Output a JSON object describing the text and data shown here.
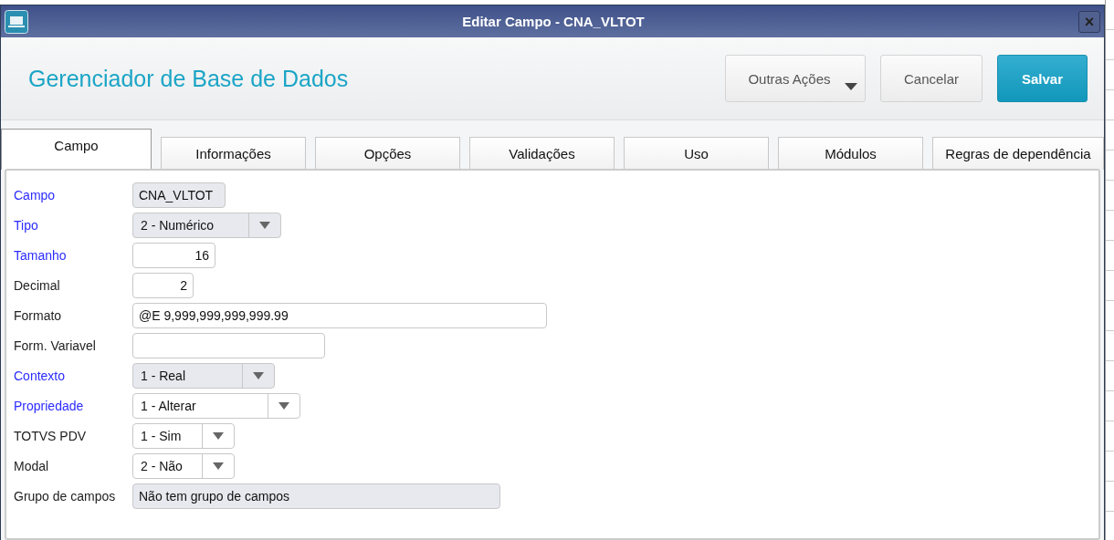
{
  "window": {
    "title": "Editar Campo - CNA_VLTOT",
    "close": "×"
  },
  "header": {
    "title": "Gerenciador de Base de Dados",
    "buttons": [
      {
        "label": "Outras Ações",
        "kind": "menu"
      },
      {
        "label": "Cancelar",
        "kind": "plain"
      },
      {
        "label": "Salvar",
        "kind": "primary"
      }
    ]
  },
  "tabs": [
    {
      "label": "Campo",
      "selected": true
    },
    {
      "label": "Informações",
      "selected": false
    },
    {
      "label": "Opções",
      "selected": false
    },
    {
      "label": "Validações",
      "selected": false
    },
    {
      "label": "Uso",
      "selected": false
    },
    {
      "label": "Módulos",
      "selected": false
    },
    {
      "label": "Regras de dependência",
      "selected": false
    }
  ],
  "fields": [
    {
      "label": "Campo",
      "required": true,
      "kind": "text",
      "value": "CNA_VLTOT",
      "disabled": true
    },
    {
      "label": "Tipo",
      "required": true,
      "kind": "select",
      "value": "2 - Numérico",
      "disabled": true
    },
    {
      "label": "Tamanho",
      "required": true,
      "kind": "number",
      "value": "16",
      "disabled": false
    },
    {
      "label": "Decimal",
      "required": false,
      "kind": "number",
      "value": "2",
      "disabled": false
    },
    {
      "label": "Formato",
      "required": false,
      "kind": "text",
      "value": "@E 9,999,999,999,999.99",
      "disabled": false
    },
    {
      "label": "Form. Variavel",
      "required": false,
      "kind": "text",
      "disabled": false
    },
    {
      "label": "Contexto",
      "required": true,
      "kind": "select",
      "value": "1 - Real",
      "disabled": true
    },
    {
      "label": "Propriedade",
      "required": true,
      "kind": "select",
      "value": "1 - Alterar",
      "disabled": false
    },
    {
      "label": "TOTVS PDV",
      "required": false,
      "kind": "select",
      "value": "1 - Sim",
      "disabled": false
    },
    {
      "label": "Modal",
      "required": false,
      "kind": "select",
      "value": "2 - Não",
      "disabled": false
    },
    {
      "label": "Grupo de campos",
      "required": false,
      "kind": "text",
      "value": "Não tem grupo de campos",
      "disabled": true
    }
  ]
}
